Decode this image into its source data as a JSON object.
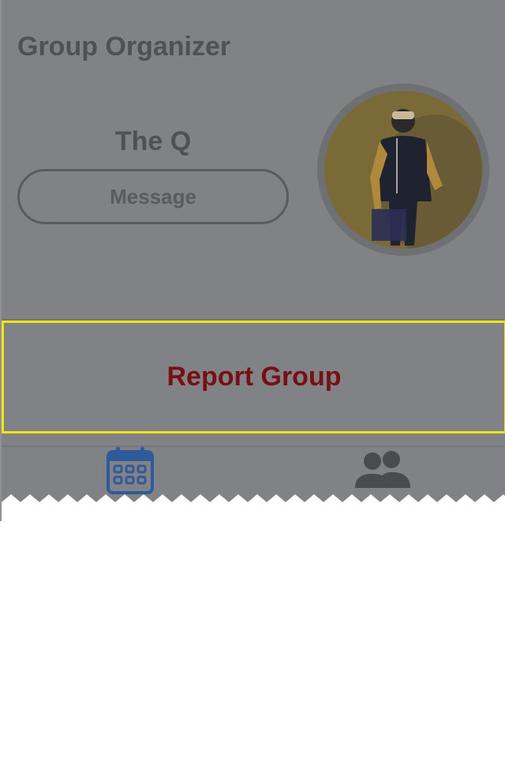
{
  "header": {
    "title": "Group Organizer"
  },
  "organizer": {
    "name": "The Q",
    "message_label": "Message",
    "avatar_icon": "organizer-photo"
  },
  "actions": {
    "report_label": "Report Group"
  },
  "tabbar": {
    "tabs": [
      {
        "icon": "calendar-icon",
        "active": true
      },
      {
        "icon": "people-icon",
        "active": false
      }
    ]
  },
  "colors": {
    "overlay": "#818285",
    "text_dim": "#505154",
    "report_text": "#780f15",
    "highlight_border": "#f1e413",
    "active_tab": "#2f5a9c",
    "inactive_tab": "#4a4b4e"
  }
}
